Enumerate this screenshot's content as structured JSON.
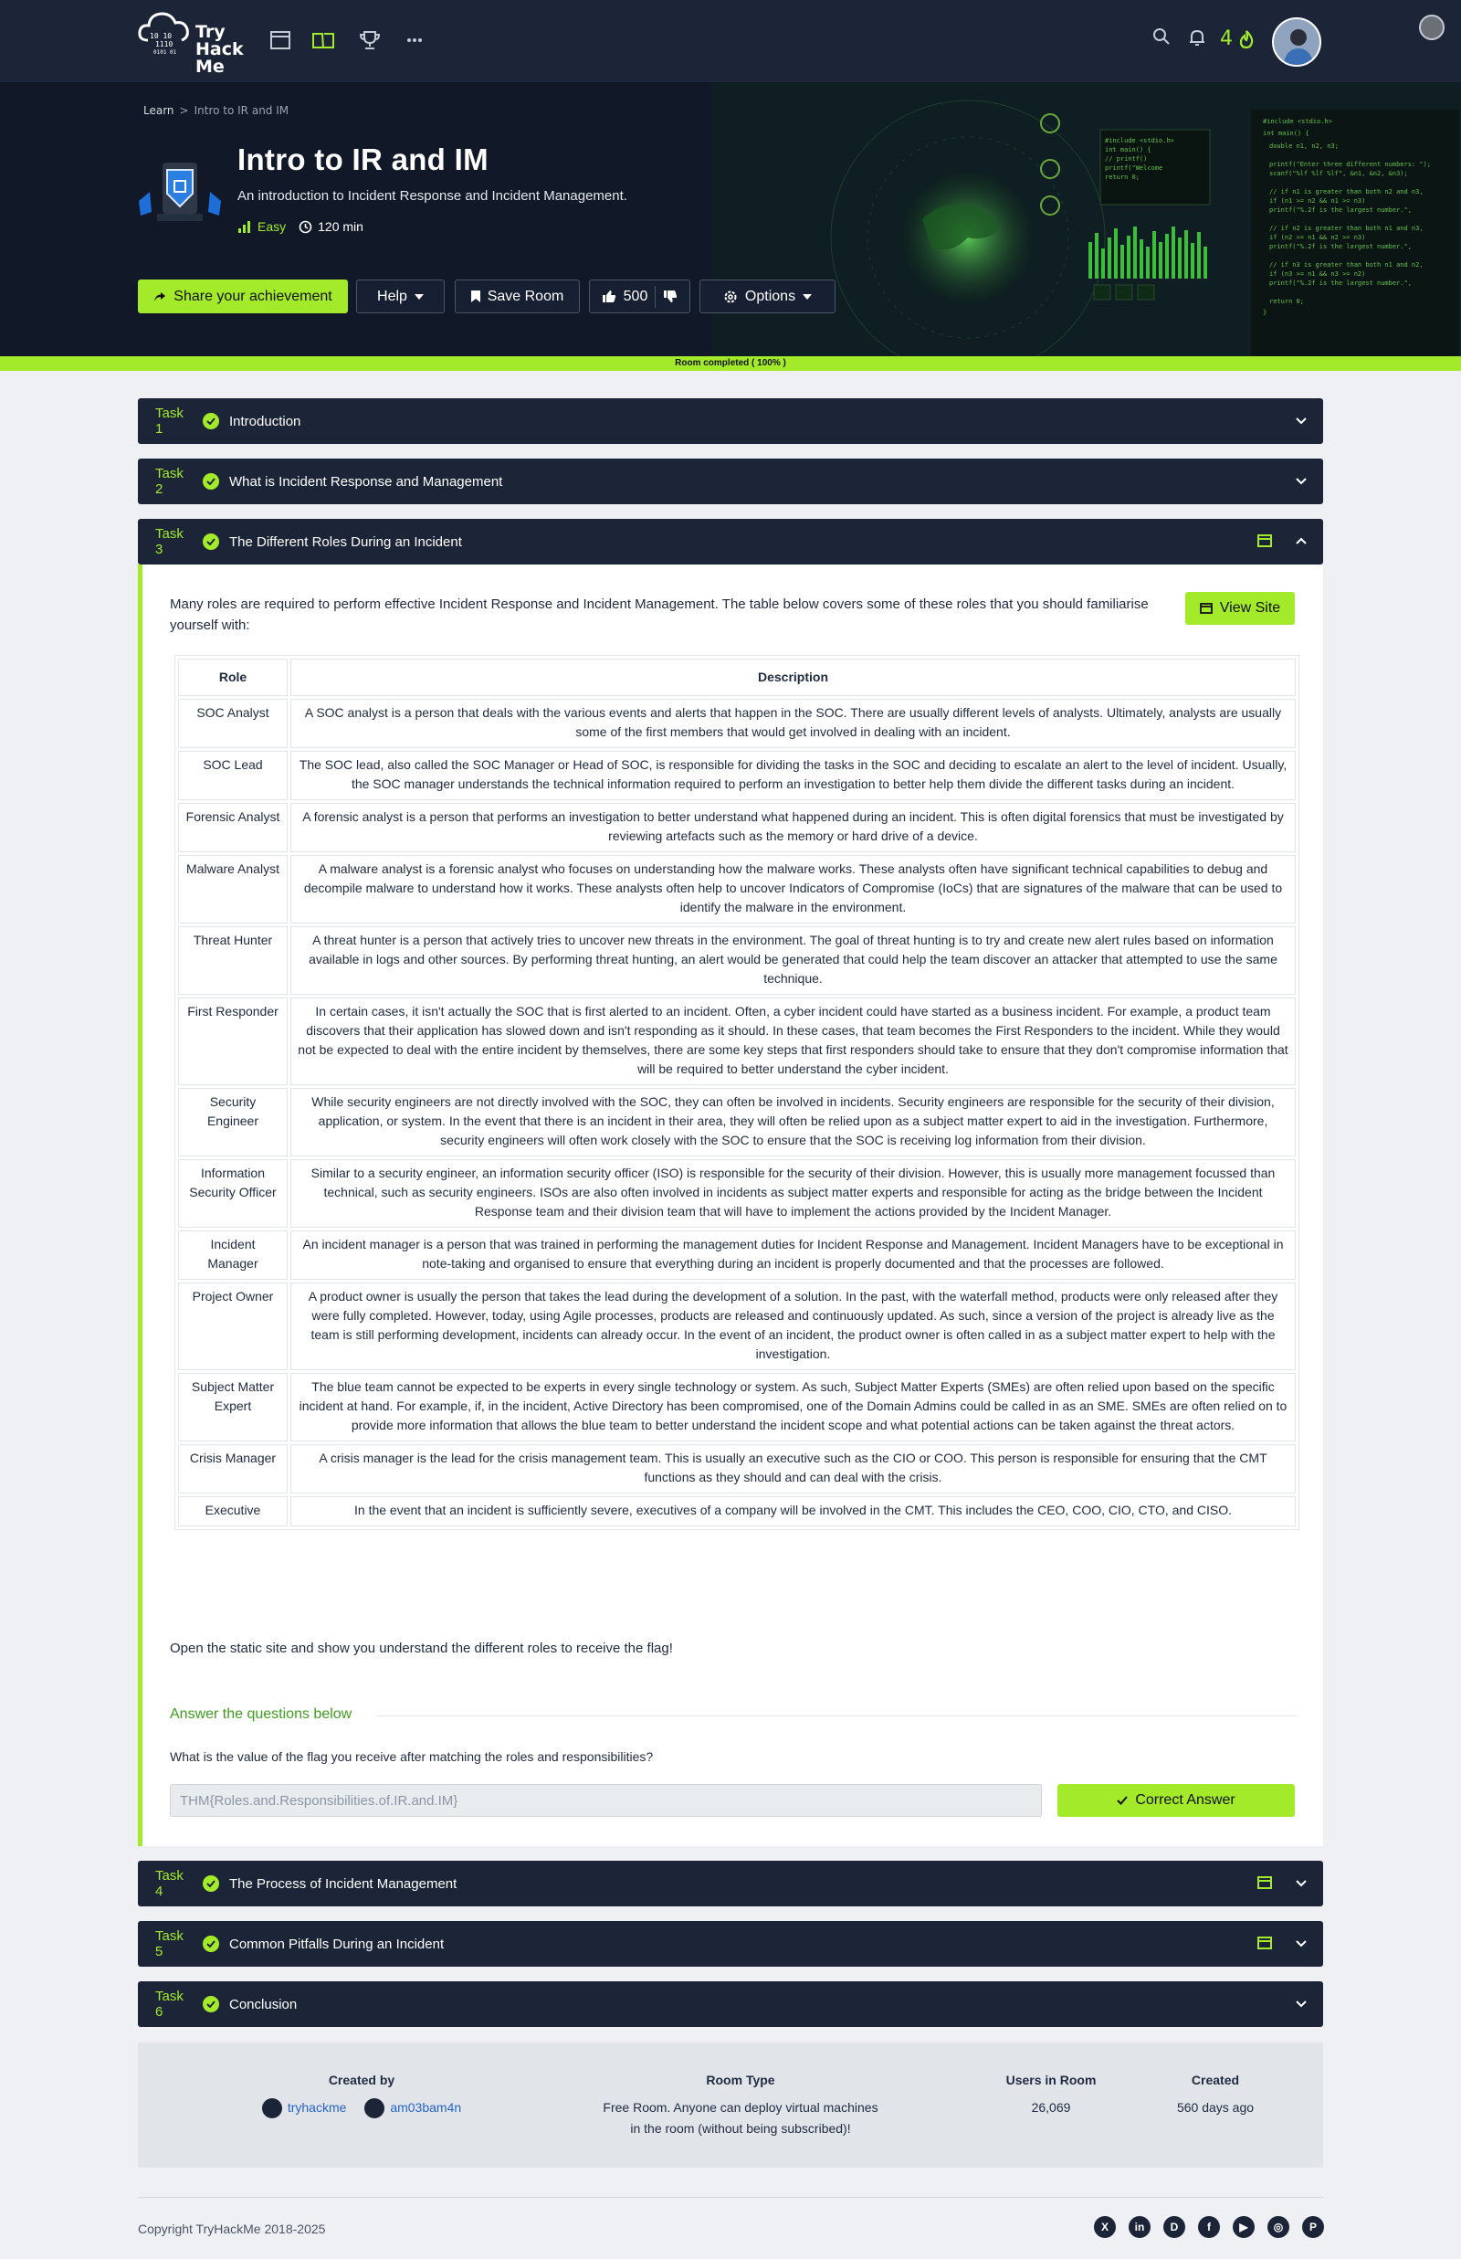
{
  "nav": {
    "logo_lines": [
      "Try",
      "Hack",
      "Me"
    ],
    "streak": "4"
  },
  "hero": {
    "breadcrumb_root": "Learn",
    "breadcrumb_sep": ">",
    "breadcrumb_current": "Intro to IR and IM",
    "title": "Intro to IR and IM",
    "subtitle": "An introduction to Incident Response and Incident Management.",
    "difficulty": "Easy",
    "duration": "120 min",
    "share_label": "Share your achievement",
    "help_label": "Help",
    "save_label": "Save Room",
    "votes": "500",
    "options_label": "Options"
  },
  "progress_label": "Room completed ( 100% )",
  "tasks": [
    {
      "num": "Task 1",
      "name": "Introduction"
    },
    {
      "num": "Task 2",
      "name": "What is Incident Response and Management"
    },
    {
      "num": "Task 3",
      "name": "The Different Roles During an Incident"
    },
    {
      "num": "Task 4",
      "name": "The Process of Incident Management"
    },
    {
      "num": "Task 5",
      "name": "Common Pitfalls During an Incident"
    },
    {
      "num": "Task 6",
      "name": "Conclusion"
    }
  ],
  "task3": {
    "intro": "Many roles are required to perform effective Incident Response and Incident Management. The table below covers some of these roles that you should familiarise yourself with:",
    "view_site": "View Site",
    "table_headers": [
      "Role",
      "Description"
    ],
    "roles": [
      {
        "role": "SOC Analyst",
        "desc": "A SOC analyst is a person that deals with the various events and alerts that happen in the SOC. There are usually different levels of analysts. Ultimately, analysts are usually some of the first members that would get involved in dealing with an incident."
      },
      {
        "role": "SOC Lead",
        "desc": "The SOC lead, also called the SOC Manager or Head of SOC, is responsible for dividing the tasks in the SOC and deciding to escalate an alert to the level of incident. Usually, the SOC manager understands the technical information required to perform an investigation to better help them divide the different tasks during an incident."
      },
      {
        "role": "Forensic Analyst",
        "desc": "A forensic analyst is a person that performs an investigation to better understand what happened during an incident. This is often digital forensics that must be investigated by reviewing artefacts such as the memory or hard drive of a device."
      },
      {
        "role": "Malware Analyst",
        "desc": "A malware analyst is a forensic analyst who focuses on understanding how the malware works. These analysts often have significant technical capabilities to debug and decompile malware to understand how it works. These analysts often help to uncover Indicators of Compromise (IoCs) that are signatures of the malware that can be used to identify the malware in the environment."
      },
      {
        "role": "Threat Hunter",
        "desc": "A threat hunter is a person that actively tries to uncover new threats in the environment. The goal of threat hunting is to try and create new alert rules based on information available in logs and other sources. By performing threat hunting, an alert would be generated that could help the team discover an attacker that attempted to use the same technique."
      },
      {
        "role": "First Responder",
        "desc": "In certain cases, it isn't actually the SOC that is first alerted to an incident. Often, a cyber incident could have started as a business incident. For example, a product team discovers that their application has slowed down and isn't responding as it should. In these cases, that team becomes the First Responders to the incident. While they would not be expected to deal with the entire incident by themselves, there are some key steps that first responders should take to ensure that they don't compromise information that will be required to better understand the cyber incident."
      },
      {
        "role": "Security Engineer",
        "desc": "While security engineers are not directly involved with the SOC, they can often be involved in incidents. Security engineers are responsible for the security of their division, application, or system. In the event that there is an incident in their area, they will often be relied upon as a subject matter expert to aid in the investigation. Furthermore, security engineers will often work closely with the SOC to ensure that the SOC is receiving log information from their division."
      },
      {
        "role": "Information Security Officer",
        "desc": "Similar to a security engineer, an information security officer (ISO) is responsible for the security of their division. However, this is usually more management focussed than technical, such as security engineers. ISOs are also often involved in incidents as subject matter experts and responsible for acting as the bridge between the Incident Response team and their division team that will have to implement the actions provided by the Incident Manager."
      },
      {
        "role": "Incident Manager",
        "desc": "An incident manager is a person that was trained in performing the management duties for Incident Response and Management. Incident Managers have to be exceptional in note-taking and organised to ensure that everything during an incident is properly documented and that the processes are followed."
      },
      {
        "role": "Project Owner",
        "desc": "A product owner is usually the person that takes the lead during the development of a solution. In the past, with the waterfall method, products were only released after they were fully completed. However, today, using Agile processes, products are released and continuously updated. As such, since a version of the project is already live as the team is still performing development, incidents can already occur. In the event of an incident, the product owner is often called in as a subject matter expert to help with the investigation."
      },
      {
        "role": "Subject Matter Expert",
        "desc": "The blue team cannot be expected to be experts in every single technology or system. As such, Subject Matter Experts (SMEs) are often relied upon based on the specific incident at hand. For example, if, in the incident, Active Directory has been compromised, one of the Domain Admins could be called in as an SME. SMEs are often relied on to provide more information that allows the blue team to better understand the incident scope and what potential actions can be taken against the threat actors."
      },
      {
        "role": "Crisis Manager",
        "desc": "A crisis manager is the lead for the crisis management team. This is usually an executive such as the CIO or COO. This person is responsible for ensuring that the CMT functions as they should and can deal with the crisis."
      },
      {
        "role": "Executive",
        "desc": "In the event that an incident is sufficiently severe, executives of a company will be involved in the CMT. This includes the CEO, COO, CIO, CTO, and CISO."
      }
    ],
    "after_text": "Open the static site and show you understand the different roles to receive the flag!",
    "answer_title": "Answer the questions below",
    "question": "What is the value of the flag you receive after matching the roles and responsibilities?",
    "answer_value": "THM{Roles.and.Responsibilities.of.IR.and.IM}",
    "correct_label": "Correct Answer"
  },
  "info": {
    "created_by_h": "Created by",
    "creators": [
      "tryhackme",
      "am03bam4n"
    ],
    "room_type_h": "Room Type",
    "room_type_v1": "Free Room. Anyone can deploy virtual machines",
    "room_type_v2": "in the room (without being subscribed)!",
    "users_h": "Users in Room",
    "users_v": "26,069",
    "created_h": "Created",
    "created_v": "560 days ago"
  },
  "footer": {
    "copyright": "Copyright TryHackMe 2018-2025",
    "socials": [
      "X",
      "in",
      "D",
      "f",
      "▶",
      "◎",
      "P"
    ]
  },
  "colors": {
    "accent": "#a3ea2a",
    "navy": "#1c2538"
  }
}
